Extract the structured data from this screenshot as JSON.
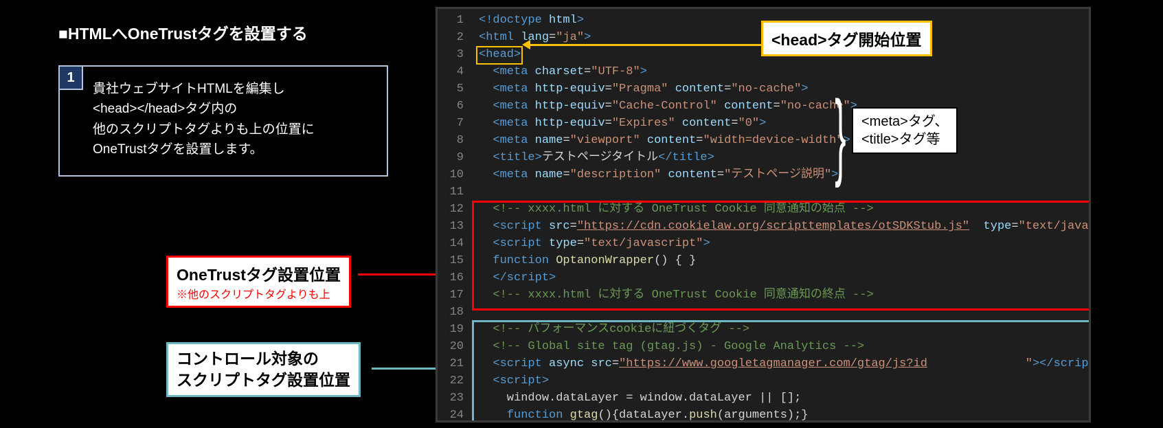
{
  "heading": "■HTMLへOneTrustタグを設置する",
  "step": {
    "num": "1",
    "text": "貴社ウェブサイトHTMLを編集し\n<head></head>タグ内の\n他のスクリプトタグよりも上の位置に\nOneTrustタグを設置します。"
  },
  "callouts": {
    "head_start": "<head>タグ開始位置",
    "meta_tags": "<meta>タグ、\n<title>タグ等",
    "onetrust_pos_title": "OneTrustタグ設置位置",
    "onetrust_pos_note": "※他のスクリプトタグよりも上",
    "control_pos": "コントロール対象の\nスクリプトタグ設置位置"
  },
  "code": {
    "lines": [
      {
        "n": "1",
        "html": "<span class='c-tag'>&lt;!doctype</span> <span class='c-attr'>html</span><span class='c-tag'>&gt;</span>"
      },
      {
        "n": "2",
        "html": "<span class='c-tag'>&lt;html</span> <span class='c-attr'>lang</span>=<span class='c-str'>\"ja\"</span><span class='c-tag'>&gt;</span>"
      },
      {
        "n": "3",
        "html": "<span class='c-tag'>&lt;head&gt;</span>"
      },
      {
        "n": "4",
        "html": "  <span class='c-tag'>&lt;meta</span> <span class='c-attr'>charset</span>=<span class='c-str'>\"UTF-8\"</span><span class='c-tag'>&gt;</span>"
      },
      {
        "n": "5",
        "html": "  <span class='c-tag'>&lt;meta</span> <span class='c-attr'>http-equiv</span>=<span class='c-str'>\"Pragma\"</span> <span class='c-attr'>content</span>=<span class='c-str'>\"no-cache\"</span><span class='c-tag'>&gt;</span>"
      },
      {
        "n": "6",
        "html": "  <span class='c-tag'>&lt;meta</span> <span class='c-attr'>http-equiv</span>=<span class='c-str'>\"Cache-Control\"</span> <span class='c-attr'>content</span>=<span class='c-str'>\"no-cache\"</span><span class='c-tag'>&gt;</span>"
      },
      {
        "n": "7",
        "html": "  <span class='c-tag'>&lt;meta</span> <span class='c-attr'>http-equiv</span>=<span class='c-str'>\"Expires\"</span> <span class='c-attr'>content</span>=<span class='c-str'>\"0\"</span><span class='c-tag'>&gt;</span>"
      },
      {
        "n": "8",
        "html": "  <span class='c-tag'>&lt;meta</span> <span class='c-attr'>name</span>=<span class='c-str'>\"viewport\"</span> <span class='c-attr'>content</span>=<span class='c-str'>\"width=device-width\"</span><span class='c-tag'>&gt;</span>"
      },
      {
        "n": "9",
        "html": "  <span class='c-tag'>&lt;title&gt;</span><span class='c-txt'>テストページタイトル</span><span class='c-tag'>&lt;/title&gt;</span>"
      },
      {
        "n": "10",
        "html": "  <span class='c-tag'>&lt;meta</span> <span class='c-attr'>name</span>=<span class='c-str'>\"description\"</span> <span class='c-attr'>content</span>=<span class='c-str'>\"テストページ説明\"</span><span class='c-tag'>&gt;</span>"
      },
      {
        "n": "11",
        "html": ""
      },
      {
        "n": "12",
        "html": "  <span class='c-cmt'>&lt;!-- xxxx.html に対する OneTrust Cookie 同意通知の始点 --&gt;</span>"
      },
      {
        "n": "13",
        "html": "  <span class='c-tag'>&lt;script</span> <span class='c-attr'>src</span>=<span class='c-url'>\"https://cdn.cookielaw.org/scripttemplates/otSDKStub.js\"</span>  <span class='c-attr'>type</span>=<span class='c-str'>\"text/javascrip</span>"
      },
      {
        "n": "14",
        "html": "  <span class='c-tag'>&lt;script</span> <span class='c-attr'>type</span>=<span class='c-str'>\"text/javascript\"</span><span class='c-tag'>&gt;</span>"
      },
      {
        "n": "15",
        "html": "  <span class='c-kw'>function</span> <span class='c-fn'>OptanonWrapper</span>() { }"
      },
      {
        "n": "16",
        "html": "  <span class='c-tag'>&lt;/script&gt;</span>"
      },
      {
        "n": "17",
        "html": "  <span class='c-cmt'>&lt;!-- xxxx.html に対する OneTrust Cookie 同意通知の終点 --&gt;</span>"
      },
      {
        "n": "18",
        "html": ""
      },
      {
        "n": "19",
        "html": "  <span class='c-cmt'>&lt;!-- パフォーマンスcookieに紐づくタグ --&gt;</span>"
      },
      {
        "n": "20",
        "html": "  <span class='c-cmt'>&lt;!-- Global site tag (gtag.js) - Google Analytics --&gt;</span>"
      },
      {
        "n": "21",
        "html": "  <span class='c-tag'>&lt;script</span> <span class='c-attr'>async</span> <span class='c-attr'>src</span>=<span class='c-url'>\"https://www.googletagmanager.com/gtag/js?id</span>              <span class='c-str'>\"</span><span class='c-tag'>&gt;&lt;/script&gt;</span>"
      },
      {
        "n": "22",
        "html": "  <span class='c-tag'>&lt;script&gt;</span>"
      },
      {
        "n": "23",
        "html": "    window.dataLayer = window.dataLayer || [];"
      },
      {
        "n": "24",
        "html": "    <span class='c-kw'>function</span> <span class='c-fn'>gtag</span>(){dataLayer.<span class='c-fn'>push</span>(arguments);}"
      }
    ]
  }
}
